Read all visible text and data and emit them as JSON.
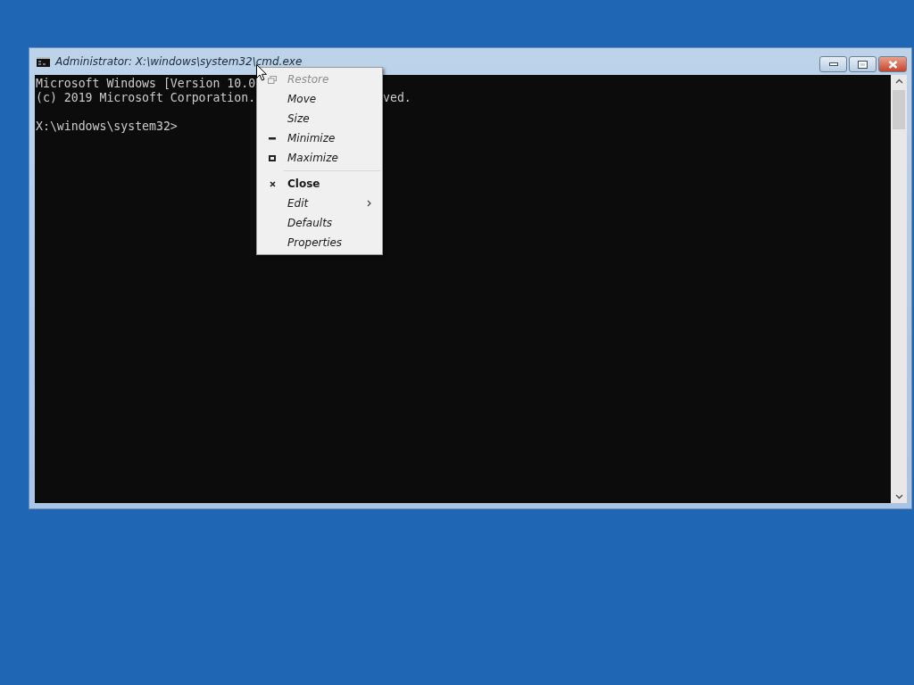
{
  "window": {
    "title": "Administrator: X:\\windows\\system32\\cmd.exe"
  },
  "console": {
    "lines": [
      {
        "segments": [
          "Microsoft Windows [Version 10.0"
        ]
      },
      {
        "segments": [
          "(c) 2019 Microsoft Corporation.",
          "ved."
        ]
      },
      {
        "segments": [
          "X:\\windows\\system32>"
        ],
        "blank_before": true
      }
    ]
  },
  "system_menu": {
    "items": [
      {
        "kind": "restore",
        "label": "Restore",
        "disabled": true,
        "default": false
      },
      {
        "kind": "plain",
        "label": "Move",
        "disabled": false,
        "default": false
      },
      {
        "kind": "plain",
        "label": "Size",
        "disabled": false,
        "default": false
      },
      {
        "kind": "minimize",
        "label": "Minimize",
        "disabled": false,
        "default": false
      },
      {
        "kind": "maximize",
        "label": "Maximize",
        "disabled": false,
        "default": false
      },
      {
        "kind": "separator"
      },
      {
        "kind": "close",
        "label": "Close",
        "disabled": false,
        "default": true
      },
      {
        "kind": "submenu",
        "label": "Edit",
        "disabled": false,
        "default": false
      },
      {
        "kind": "plain",
        "label": "Defaults",
        "disabled": false,
        "default": false
      },
      {
        "kind": "plain",
        "label": "Properties",
        "disabled": false,
        "default": false
      }
    ]
  }
}
